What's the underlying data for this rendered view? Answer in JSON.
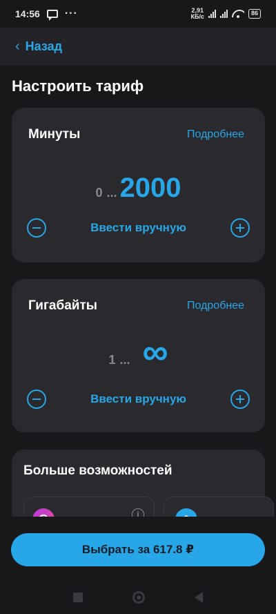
{
  "status_bar": {
    "time": "14:56",
    "dots": "···",
    "speed_value": "2,91",
    "speed_unit": "КБ/с",
    "battery": "86"
  },
  "nav": {
    "back_label": "Назад"
  },
  "page_title": "Настроить тариф",
  "minutes_card": {
    "title": "Минуты",
    "details_link": "Подробнее",
    "range_min": "0",
    "range_dots": "...",
    "range_max": "2000",
    "manual_label": "Ввести вручную"
  },
  "gb_card": {
    "title": "Гигабайты",
    "details_link": "Подробнее",
    "range_min": "1",
    "range_dots": "...",
    "range_max": "∞",
    "manual_label": "Ввести вручную"
  },
  "more_card": {
    "title": "Больше возможностей",
    "info_glyph": "i"
  },
  "cta": {
    "label": "Выбрать за 617.8 ₽"
  },
  "colors": {
    "accent": "#27a7e7",
    "background": "#18181b",
    "card": "#2a2a2e"
  }
}
